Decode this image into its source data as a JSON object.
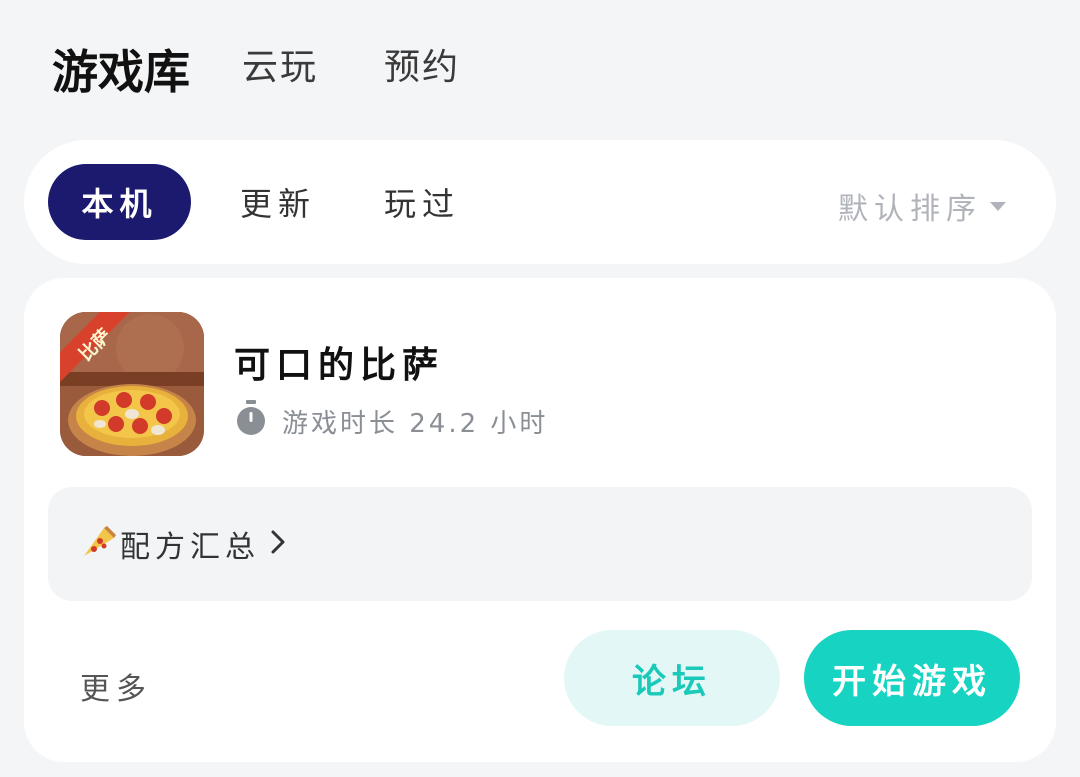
{
  "top_tabs": [
    {
      "label": "游戏库",
      "active": true
    },
    {
      "label": "云玩",
      "active": false
    },
    {
      "label": "预约",
      "active": false
    }
  ],
  "filter": {
    "chips": [
      {
        "label": "本机",
        "active": true
      },
      {
        "label": "更新",
        "active": false
      },
      {
        "label": "玩过",
        "active": false
      }
    ],
    "sort_label": "默认排序"
  },
  "game": {
    "title": "可口的比萨",
    "icon_badge": "比萨",
    "playtime": "游戏时长 24.2 小时",
    "recipe_label": "配方汇总",
    "more_label": "更多",
    "forum_label": "论坛",
    "play_label": "开始游戏"
  },
  "colors": {
    "accent": "#17d3c1",
    "chip_active": "#1c1a6e",
    "background": "#f4f5f7"
  }
}
